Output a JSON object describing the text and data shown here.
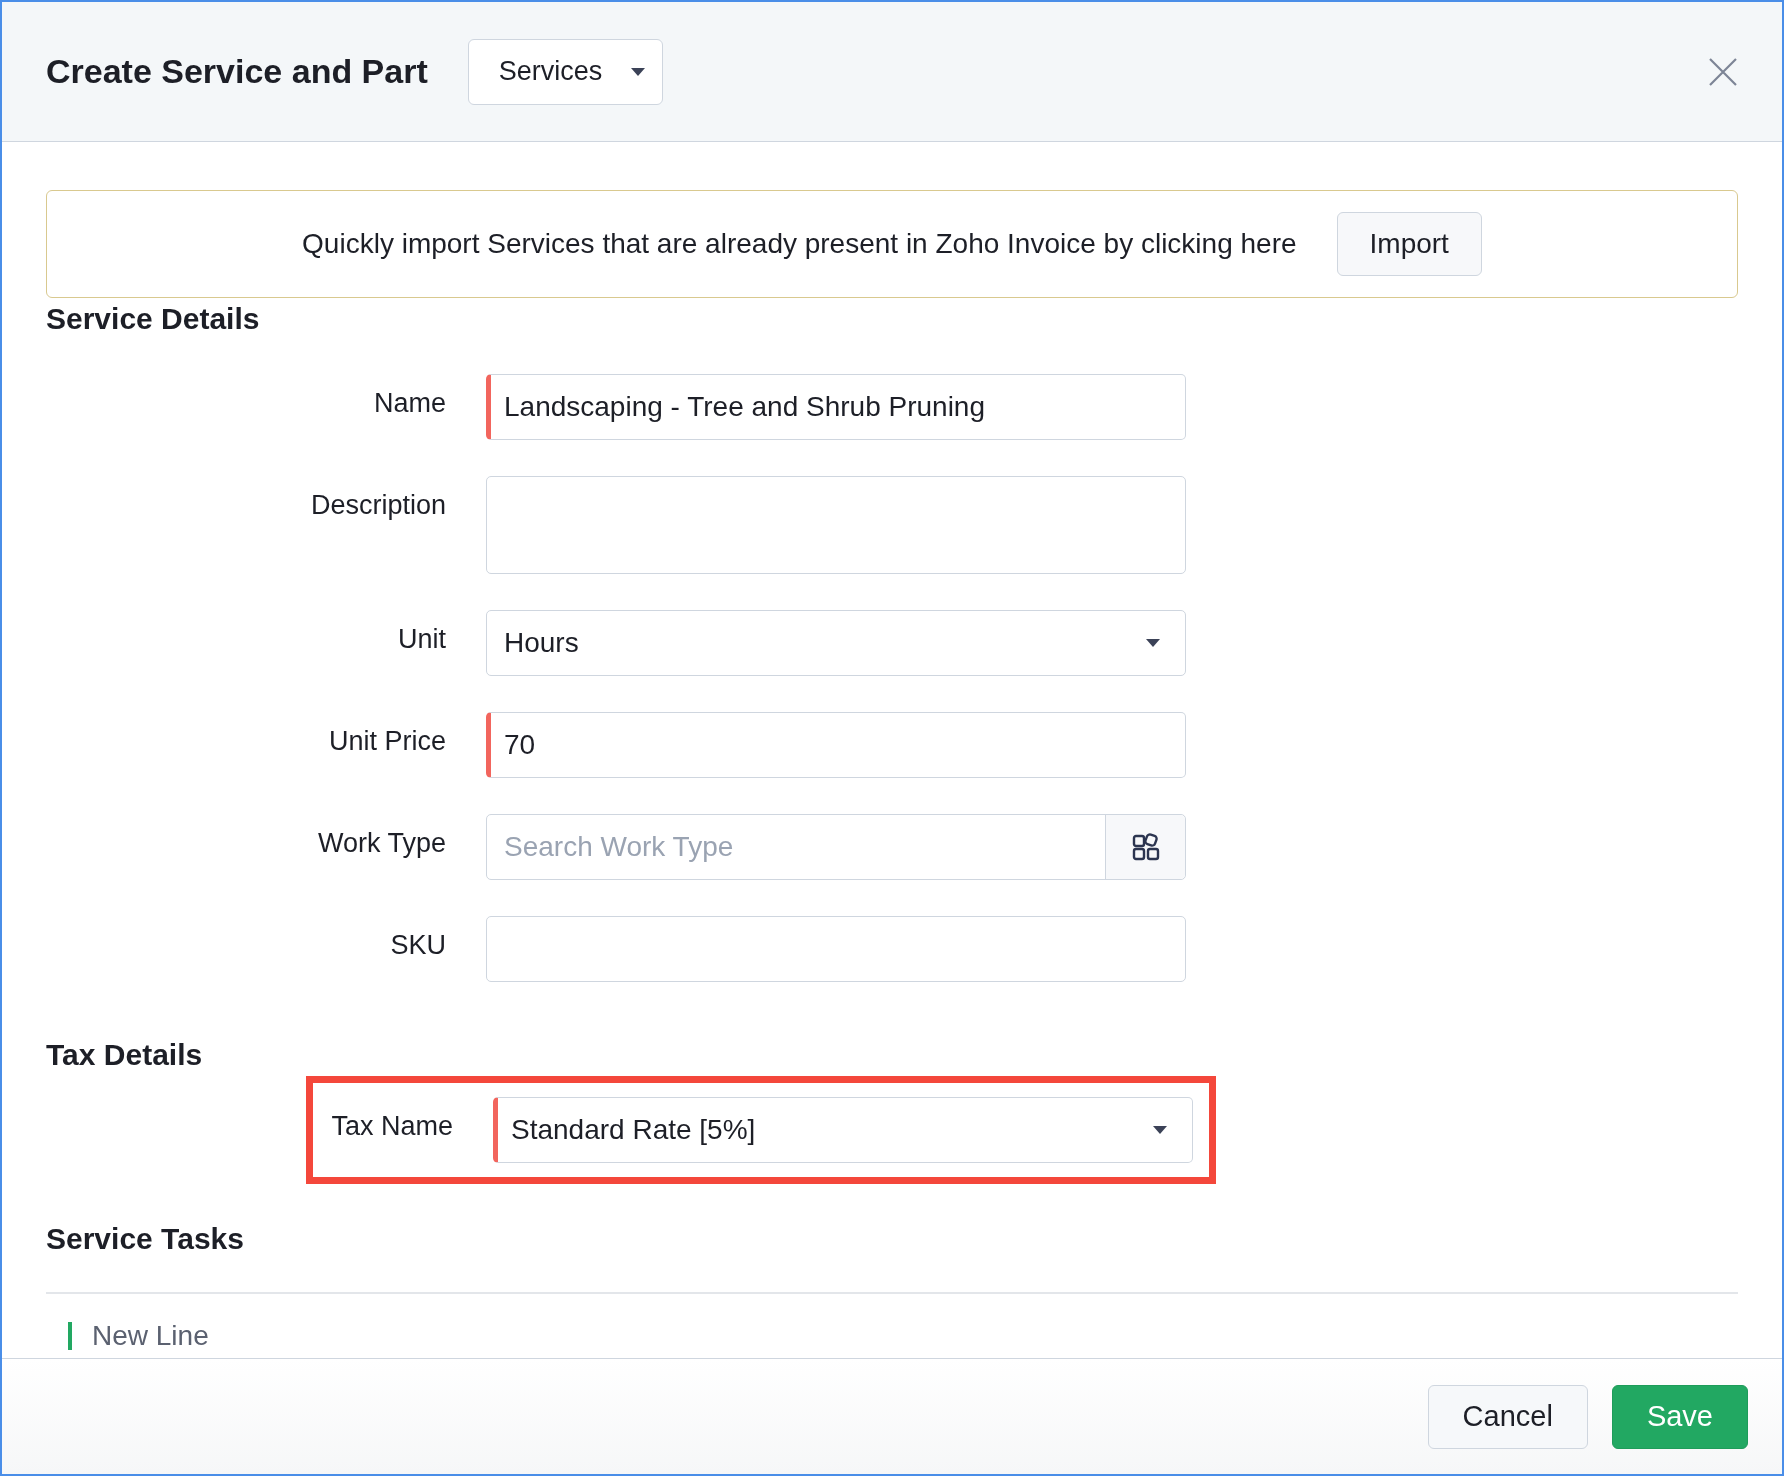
{
  "dialog": {
    "title": "Create Service and Part",
    "type_selector": "Services"
  },
  "banner": {
    "text": "Quickly import Services that are already present in Zoho Invoice by clicking here",
    "button": "Import"
  },
  "service_details": {
    "heading": "Service Details",
    "fields": [
      {
        "label": "Name",
        "kind": "text",
        "value": "Landscaping - Tree and Shrub Pruning",
        "required": true
      },
      {
        "label": "Description",
        "kind": "textarea",
        "required": false
      },
      {
        "label": "Unit",
        "kind": "select",
        "value": "Hours",
        "required": false
      },
      {
        "label": "Unit Price",
        "kind": "text",
        "value": "70",
        "required": true
      },
      {
        "label": "Work Type",
        "kind": "search",
        "placeholder": "Search Work Type",
        "required": false
      },
      {
        "label": "SKU",
        "kind": "text",
        "required": false
      }
    ]
  },
  "tax_details": {
    "heading": "Tax Details",
    "fields": [
      {
        "label": "Tax Name",
        "kind": "select",
        "value": "Standard Rate [5%]",
        "required": true,
        "highlighted": true
      }
    ]
  },
  "service_tasks": {
    "heading": "Service Tasks",
    "new_line": "New Line"
  },
  "footer": {
    "buttons": [
      {
        "label": "Cancel",
        "kind": "secondary"
      },
      {
        "label": "Save",
        "kind": "primary"
      }
    ]
  }
}
